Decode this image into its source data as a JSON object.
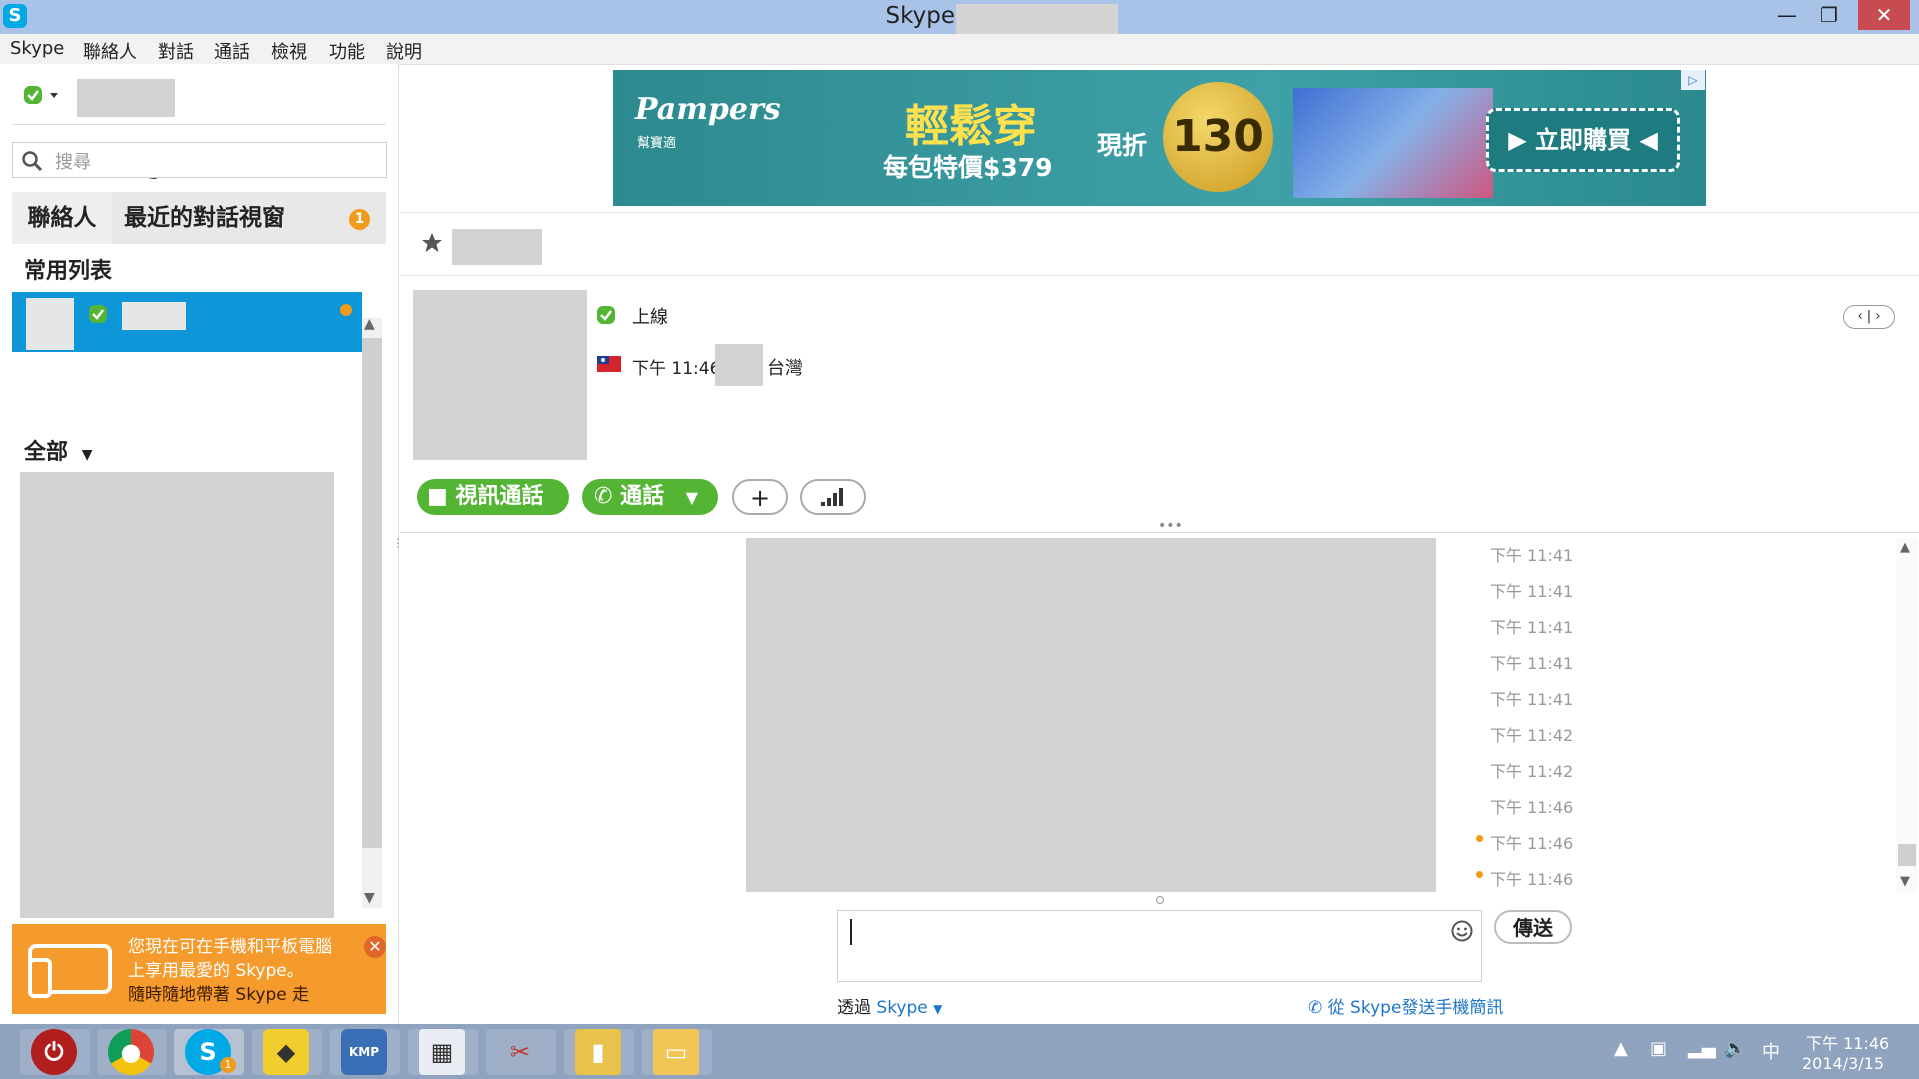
{
  "window": {
    "title": "Skype™ [1] -",
    "minimize": "—",
    "restore": "❐",
    "close": "✕"
  },
  "menu": [
    "Skype",
    "聯絡人",
    "對話",
    "通話",
    "檢視",
    "功能",
    "說明"
  ],
  "left": {
    "search_placeholder": "搜尋",
    "tabs": {
      "contacts": "聯絡人",
      "recent": "最近的對話視窗",
      "recent_badge": "1"
    },
    "favorites_heading": "常用列表",
    "all_heading": "全部",
    "promo": {
      "line1": "您現在可在手機和平板電腦",
      "line2": "上享用最愛的 Skype。",
      "line3": "隨時隨地帶著 Skype 走",
      "close": "✕"
    }
  },
  "ad": {
    "brand": "Pampers",
    "brand_sub": "幫寶適",
    "headline": "輕鬆穿",
    "price_text": "每包特價$379",
    "discount_label": "現折",
    "discount_value": "130",
    "buy_button": "立即購買"
  },
  "contact": {
    "status": "上線",
    "local_time": "下午 11:46",
    "country": "台灣"
  },
  "actions": {
    "video_call": "視訊通話",
    "call": "通話",
    "add": "+",
    "quality": "📶"
  },
  "chat": {
    "timestamps": [
      {
        "time": "下午 11:41",
        "unread": false
      },
      {
        "time": "下午 11:41",
        "unread": false
      },
      {
        "time": "下午 11:41",
        "unread": false
      },
      {
        "time": "下午 11:41",
        "unread": false
      },
      {
        "time": "下午 11:41",
        "unread": false
      },
      {
        "time": "下午 11:42",
        "unread": false
      },
      {
        "time": "下午 11:42",
        "unread": false
      },
      {
        "time": "下午 11:46",
        "unread": false
      },
      {
        "time": "下午 11:46",
        "unread": true
      },
      {
        "time": "下午 11:46",
        "unread": true
      }
    ],
    "send": "傳送",
    "via_label": "透過",
    "via_service": "Skype",
    "sms_link": "從 Skype發送手機簡訊"
  },
  "taskbar": {
    "skype_badge": "1",
    "kmp_label": "KMP",
    "ime": "中",
    "clock_time": "下午 11:46",
    "clock_date": "2014/3/15"
  },
  "colors": {
    "accent": "#0d97d8",
    "green": "#53b533",
    "orange": "#f59a2c",
    "titlebar": "#a9c3e8"
  }
}
